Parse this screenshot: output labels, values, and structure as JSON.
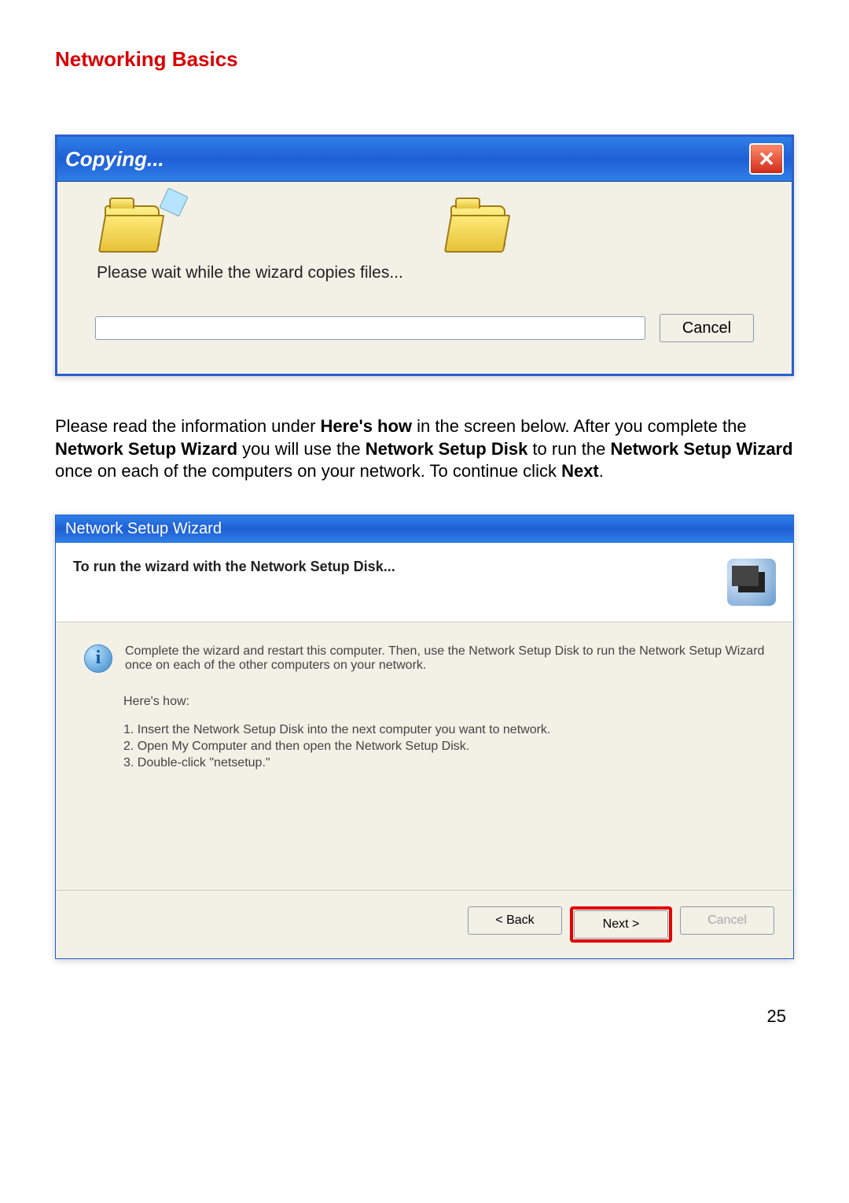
{
  "section_title": "Networking Basics",
  "copying_dialog": {
    "title": "Copying...",
    "message": "Please wait while the wizard copies files...",
    "cancel_label": "Cancel"
  },
  "body_text": {
    "t1": "Please read the information under ",
    "b1": "Here's how",
    "t2": " in the screen below.  After you complete the ",
    "b2": "Network Setup Wizard",
    "t3": " you will use the ",
    "b3": "Network Setup Disk",
    "t4": " to run the ",
    "b4": "Network Setup Wizard",
    "t5": " once on each of the computers on your network.  To continue click ",
    "b5": "Next",
    "t6": "."
  },
  "wizard_dialog": {
    "title": "Network Setup Wizard",
    "header_text": "To run the wizard with the Network Setup Disk...",
    "info_text": "Complete the wizard and restart this computer. Then, use the Network Setup Disk to run the Network Setup Wizard once on each of the other computers on your network.",
    "heres_how": "Here's how:",
    "steps": [
      "1.  Insert the Network Setup Disk into the next computer you want to network.",
      "2.  Open My Computer and then open the Network Setup Disk.",
      "3.  Double-click \"netsetup.\""
    ],
    "back_label": "< Back",
    "next_label": "Next >",
    "cancel_label": "Cancel"
  },
  "page_number": "25"
}
